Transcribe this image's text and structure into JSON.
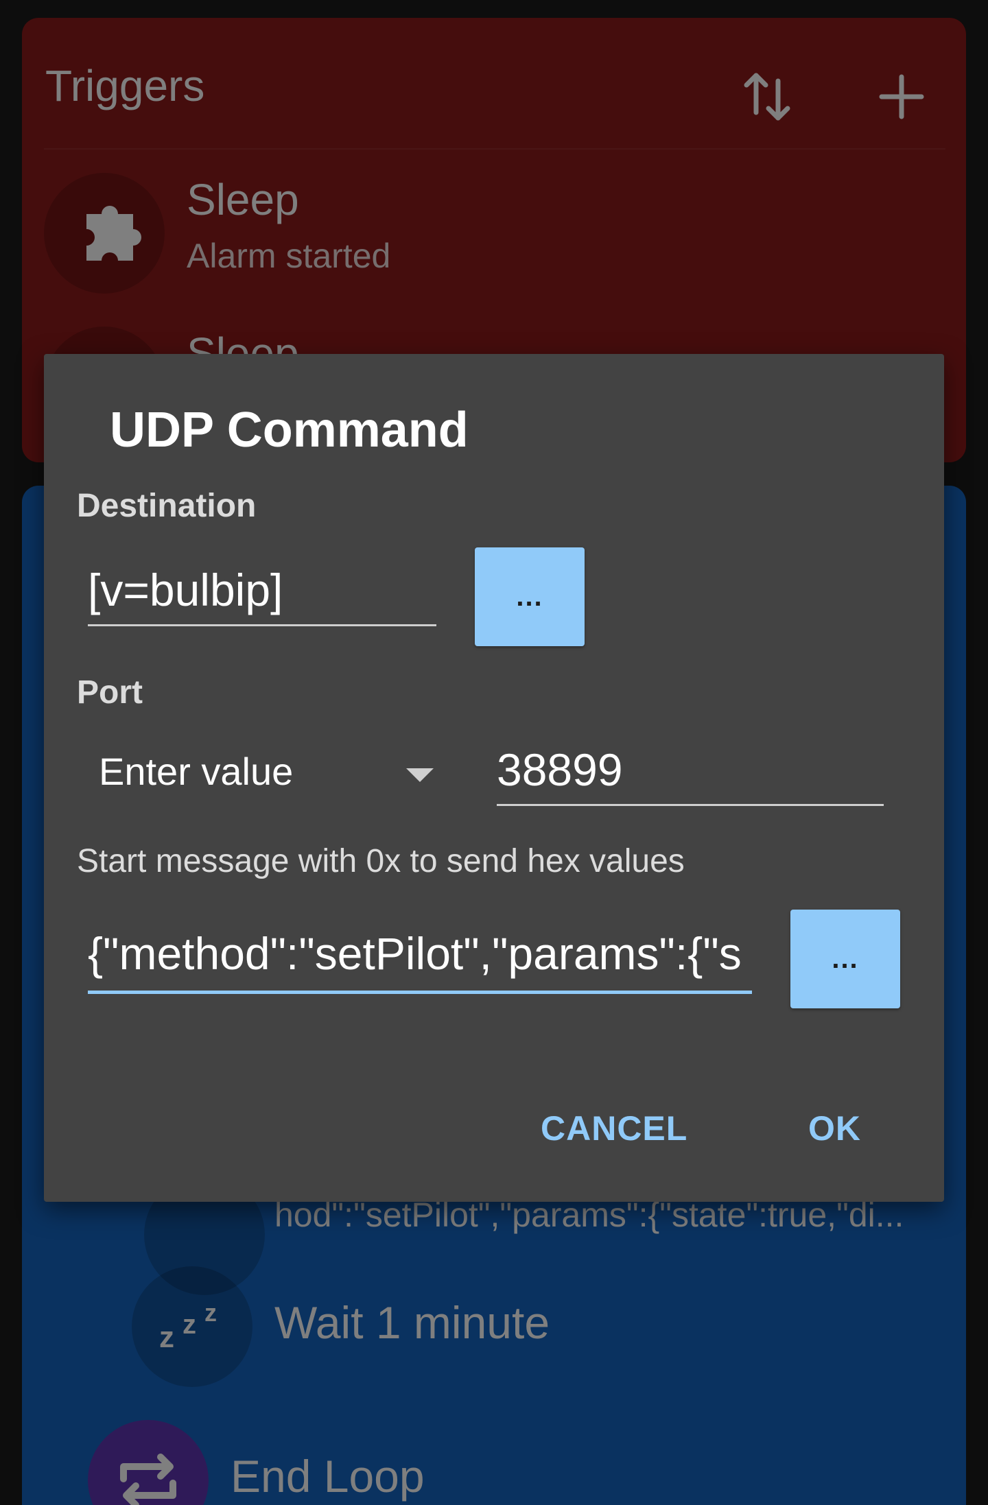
{
  "triggers": {
    "title": "Triggers",
    "items": [
      {
        "title": "Sleep",
        "subtitle": "Alarm started",
        "icon": "puzzle-icon"
      },
      {
        "title": "Sleep",
        "icon": "puzzle-icon"
      }
    ]
  },
  "actions": {
    "partial_text": "hod\":\"setPilot\",\"params\":{\"state\":true,\"di...",
    "items": [
      {
        "label": "Wait 1 minute",
        "icon": "sleep-zzz-icon"
      },
      {
        "label": "End Loop",
        "icon": "loop-icon"
      }
    ]
  },
  "dialog": {
    "title": "UDP Command",
    "destination": {
      "label": "Destination",
      "value": "[v=bulbip]",
      "button": "..."
    },
    "port": {
      "label": "Port",
      "mode": "Enter value",
      "value": "38899"
    },
    "message": {
      "hint": "Start message with 0x to send hex values",
      "value": "{\"method\":\"setPilot\",\"params\":{\"s",
      "button": "..."
    },
    "buttons": {
      "cancel": "CANCEL",
      "ok": "OK"
    }
  },
  "colors": {
    "triggers_bg": "#8b1a1a",
    "actions_bg": "#1565c0",
    "dialog_bg": "#434343",
    "accent": "#90caf9",
    "end_loop_avatar": "#5e35b1"
  }
}
